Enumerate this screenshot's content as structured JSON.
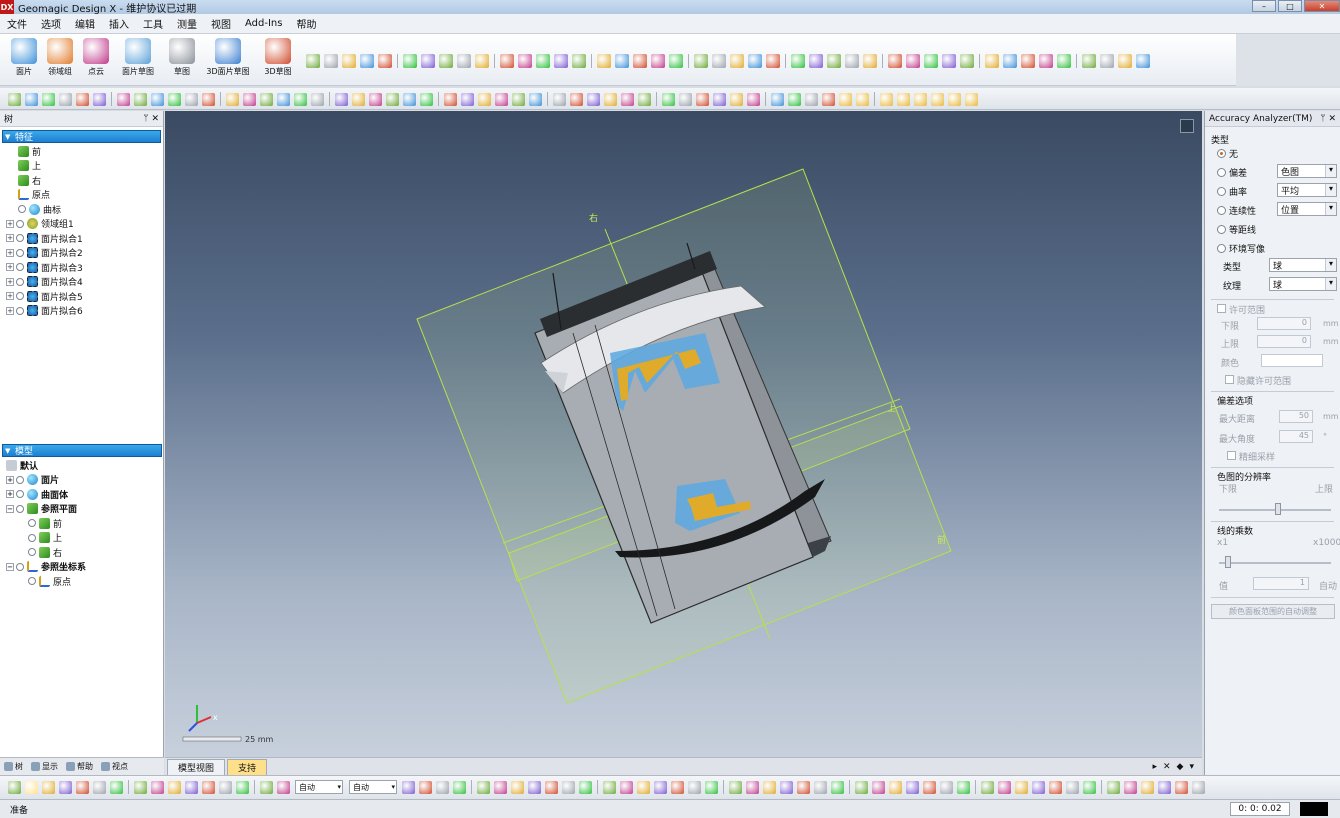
{
  "window": {
    "logo": "DX",
    "title": "Geomagic Design X - 维护协议已过期"
  },
  "menu": [
    "文件",
    "选项",
    "编辑",
    "插入",
    "工具",
    "测量",
    "视图",
    "Add-Ins",
    "帮助"
  ],
  "ribbon": {
    "tools": [
      {
        "label": "面片",
        "color": "#3b8fd8"
      },
      {
        "label": "领域组",
        "color": "#e07b2a"
      },
      {
        "label": "点云",
        "color": "#c0398a"
      },
      {
        "label": "面片草图",
        "color": "#5aa0d8"
      },
      {
        "label": "草图",
        "color": "#8a9099"
      },
      {
        "label": "3D面片草图",
        "color": "#3b7fd0"
      },
      {
        "label": "3D草图",
        "color": "#d04a2a"
      }
    ]
  },
  "tree_panel": {
    "title": "树",
    "features_header": "特征",
    "features": [
      {
        "label": "前",
        "icon": "plane"
      },
      {
        "label": "上",
        "icon": "plane"
      },
      {
        "label": "右",
        "icon": "plane"
      },
      {
        "label": "原点",
        "icon": "axis"
      },
      {
        "label": "曲标",
        "icon": "ball"
      },
      {
        "label": "领域组1",
        "icon": "region"
      },
      {
        "label": "面片拟合1",
        "icon": "fit"
      },
      {
        "label": "面片拟合2",
        "icon": "fit"
      },
      {
        "label": "面片拟合3",
        "icon": "fit"
      },
      {
        "label": "面片拟合4",
        "icon": "fit"
      },
      {
        "label": "面片拟合5",
        "icon": "fit"
      },
      {
        "label": "面片拟合6",
        "icon": "fit"
      }
    ],
    "model_header": "模型",
    "model_default": "默认",
    "model": [
      {
        "label": "面片",
        "icon": "ball",
        "level": 1,
        "bold": true
      },
      {
        "label": "曲面体",
        "icon": "ball",
        "level": 1,
        "bold": true
      },
      {
        "label": "参照平面",
        "icon": "plane",
        "level": 1,
        "bold": true
      },
      {
        "label": "前",
        "icon": "plane",
        "level": 2,
        "bold": false
      },
      {
        "label": "上",
        "icon": "plane",
        "level": 2,
        "bold": false
      },
      {
        "label": "右",
        "icon": "plane",
        "level": 2,
        "bold": false
      },
      {
        "label": "参照坐标系",
        "icon": "axis",
        "level": 1,
        "bold": true
      },
      {
        "label": "原点",
        "icon": "axis",
        "level": 2,
        "bold": false
      }
    ],
    "bottom_tabs": [
      "树",
      "显示",
      "帮助",
      "视点"
    ]
  },
  "viewport": {
    "label_right_top": "右",
    "label_up": "上",
    "label_front": "前",
    "scale_text": "25 mm",
    "axis_x": "x",
    "tabs": [
      "模型视图",
      "支持"
    ],
    "active_tab": 1
  },
  "accuracy": {
    "title": "Accuracy Analyzer(TM)",
    "type_label": "类型",
    "options": [
      {
        "label": "无",
        "selected": true
      },
      {
        "label": "偏差",
        "selected": false,
        "combo": "色图"
      },
      {
        "label": "曲率",
        "selected": false,
        "combo": "平均"
      },
      {
        "label": "连续性",
        "selected": false,
        "combo": "位置"
      },
      {
        "label": "等距线",
        "selected": false
      },
      {
        "label": "环境写像",
        "selected": false
      }
    ],
    "style_type_label": "类型",
    "style_type_value": "球",
    "texture_label": "纹理",
    "texture_value": "球",
    "tolerance_label": "许可范围",
    "lower_label": "下限",
    "lower_value": "0",
    "upper_label": "上限",
    "upper_value": "0",
    "unit_mm": "mm",
    "color_label": "颜色",
    "hide_tolerance": "隐藏许可范围",
    "dev_options": "偏差选项",
    "max_distance_label": "最大距离",
    "max_distance_value": "50",
    "max_angle_label": "最大角度",
    "max_angle_value": "45",
    "deg_unit": "°",
    "detail_sampling": "精细采样",
    "colormap_res": "色图的分辨率",
    "res_lower": "下限",
    "res_upper": "上限",
    "line_mult": "线的乘数",
    "mult_min": "x1",
    "mult_max": "x1000",
    "value_label": "值",
    "value_value": "1",
    "auto_label": "自动",
    "auto_adjust_button": "颜色面板范围的自动调整"
  },
  "bottom_toolbar": {
    "combo1": "自动",
    "combo2": "自动"
  },
  "status": {
    "text": "准备",
    "time": "0: 0: 0.02"
  }
}
